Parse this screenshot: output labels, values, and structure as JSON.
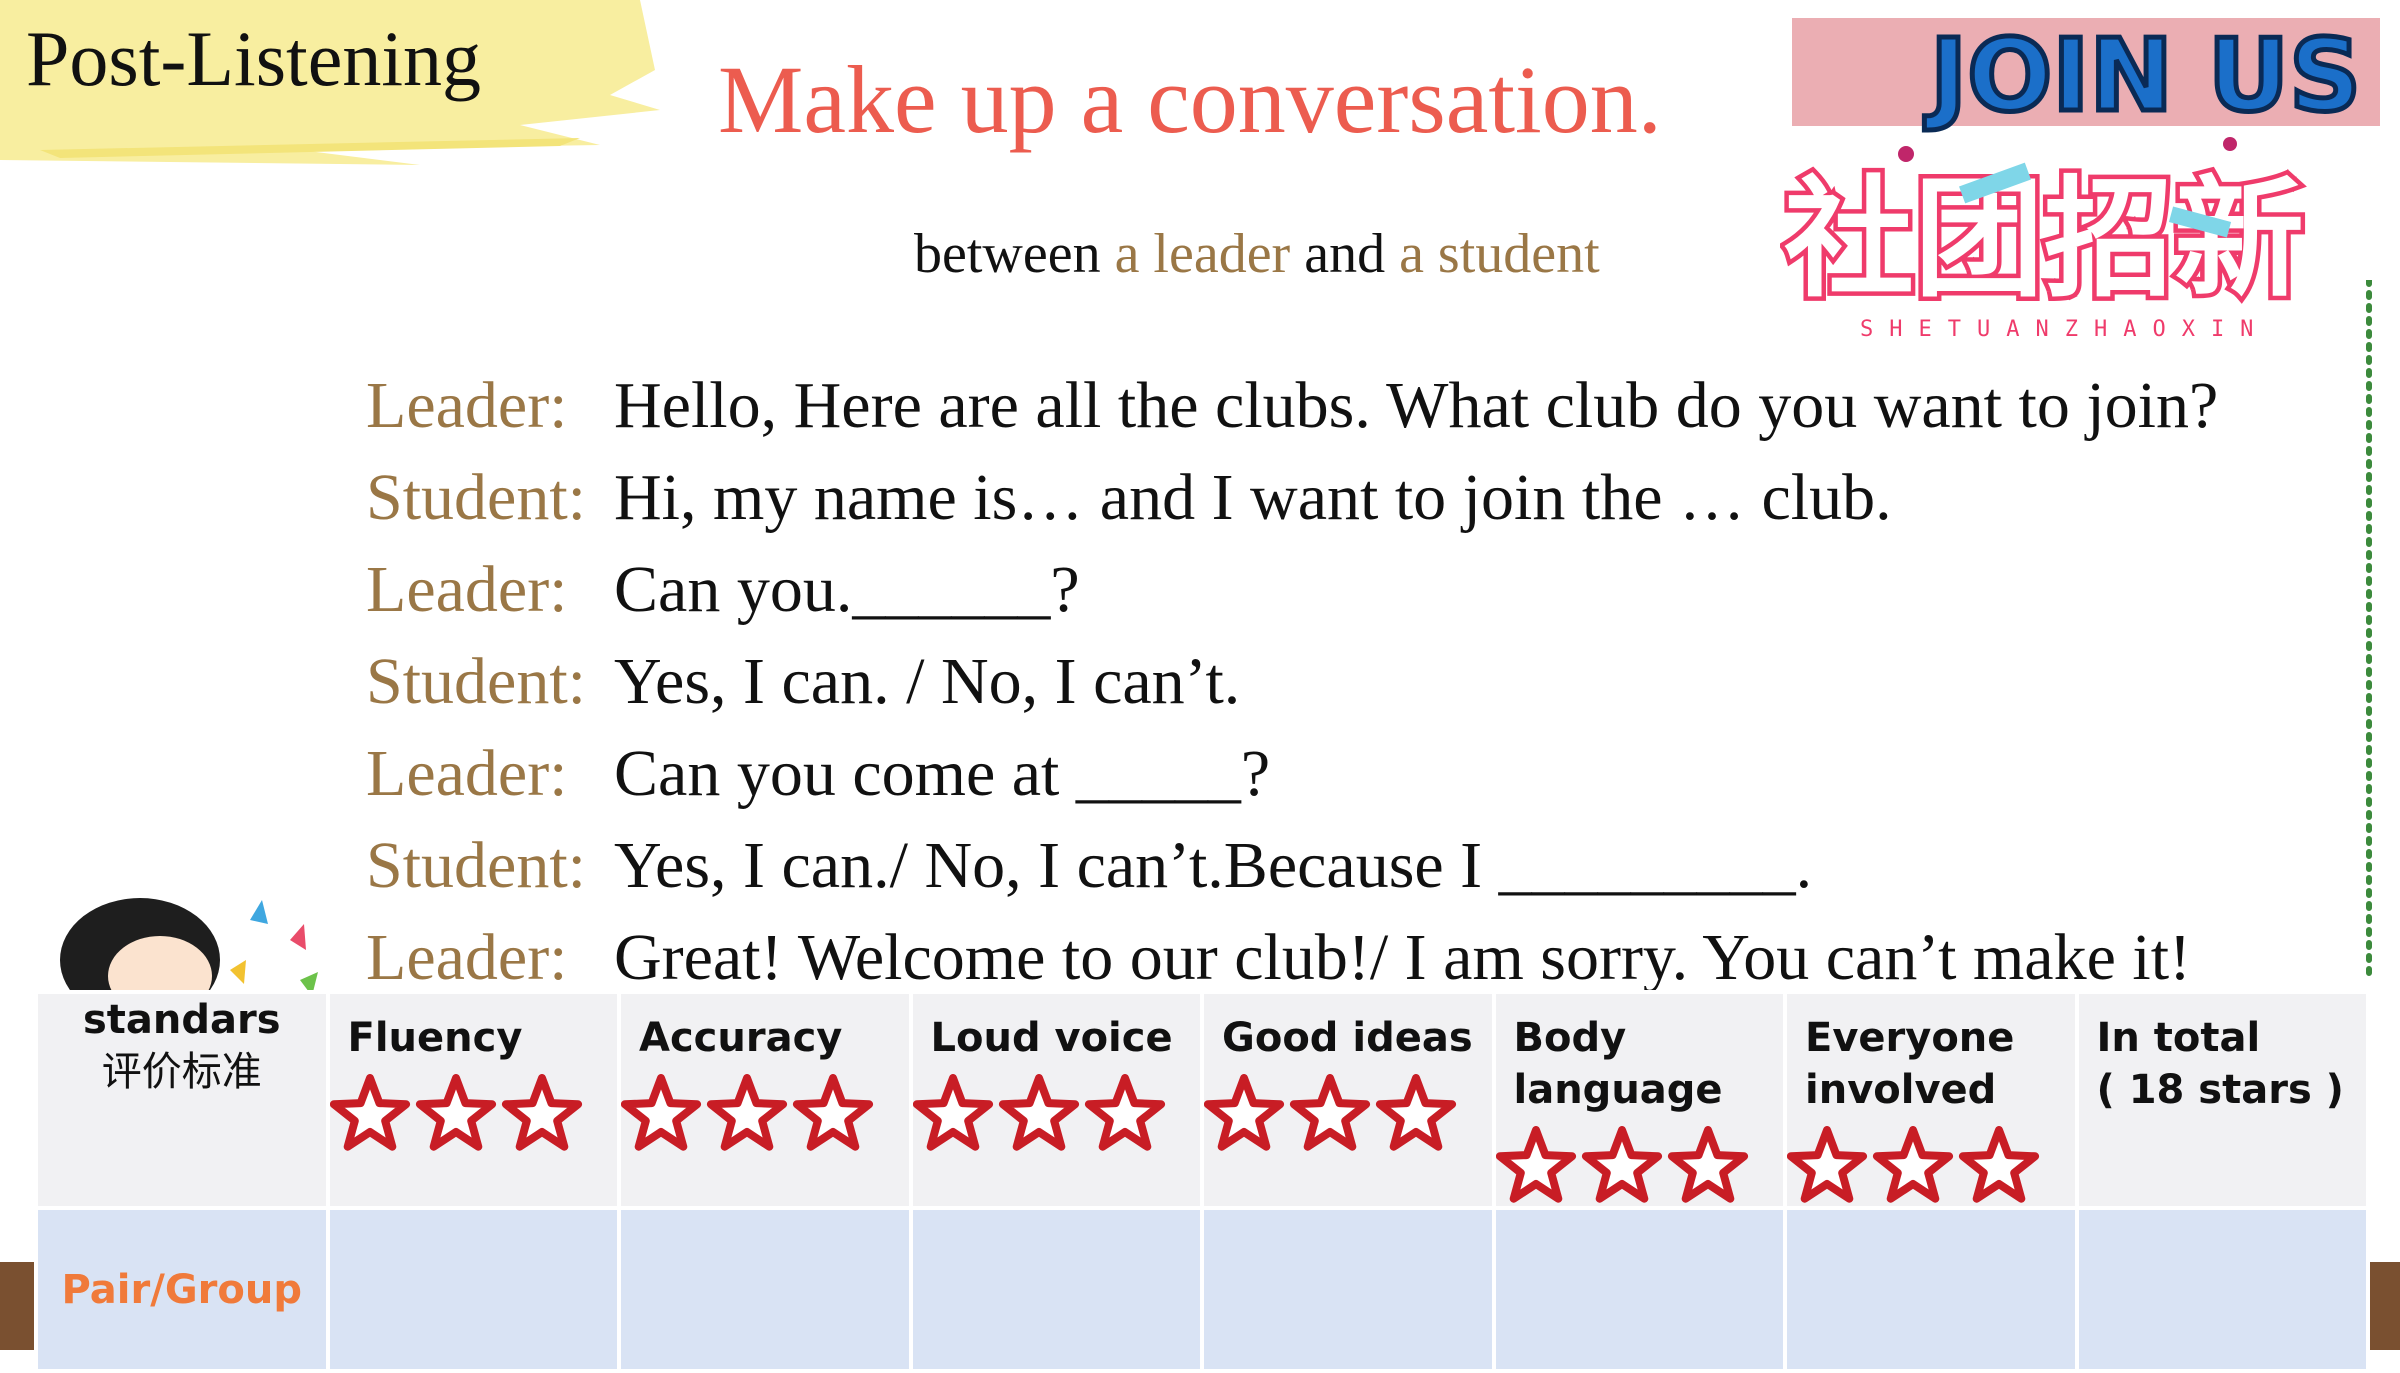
{
  "header": {
    "section_tag": "Post-Listening",
    "title": "Make up a conversation.",
    "subtitle": {
      "prefix": "between ",
      "role1": "a leader",
      "middle": " and ",
      "role2": "a student"
    }
  },
  "logo": {
    "line1": "JOIN US",
    "line2": "社团招新",
    "pinyin": "SHETUANZHAOXIN"
  },
  "dialogue": [
    {
      "speaker": "Leader:",
      "text": "Hello, Here are all the clubs. What club do you want to join?"
    },
    {
      "speaker": "Student:",
      "text": "Hi, my name is… and I want to join the … club."
    },
    {
      "speaker": "Leader:",
      "text": "Can you.______?"
    },
    {
      "speaker": "Student:",
      "text": "Yes, I can. / No, I can’t."
    },
    {
      "speaker": "Leader:",
      "text": "Can you come at _____?"
    },
    {
      "speaker": "Student:",
      "text": "Yes, I can./ No, I can’t.Because I _________."
    },
    {
      "speaker": "Leader:",
      "text": "Great! Welcome to our club!/ I am sorry. You can’t make it!"
    }
  ],
  "rubric": {
    "standards_en": "standars",
    "standards_zh": "评价标准",
    "criteria": [
      {
        "label": "Fluency",
        "stars": 3
      },
      {
        "label": "Accuracy",
        "stars": 3
      },
      {
        "label": "Loud voice",
        "stars": 3
      },
      {
        "label": "Good ideas",
        "stars": 3
      },
      {
        "label": "Body language",
        "stars": 3
      },
      {
        "label": "Everyone involved",
        "stars": 3
      }
    ],
    "total_label": "In total",
    "total_note": "( 18 stars )",
    "row_label": "Pair/Group"
  },
  "colors": {
    "title": "#ec5c4f",
    "speaker": "#9a7746",
    "star_outline": "#c81d25",
    "row_label": "#f07a3a",
    "brush": "#f8eea0"
  }
}
